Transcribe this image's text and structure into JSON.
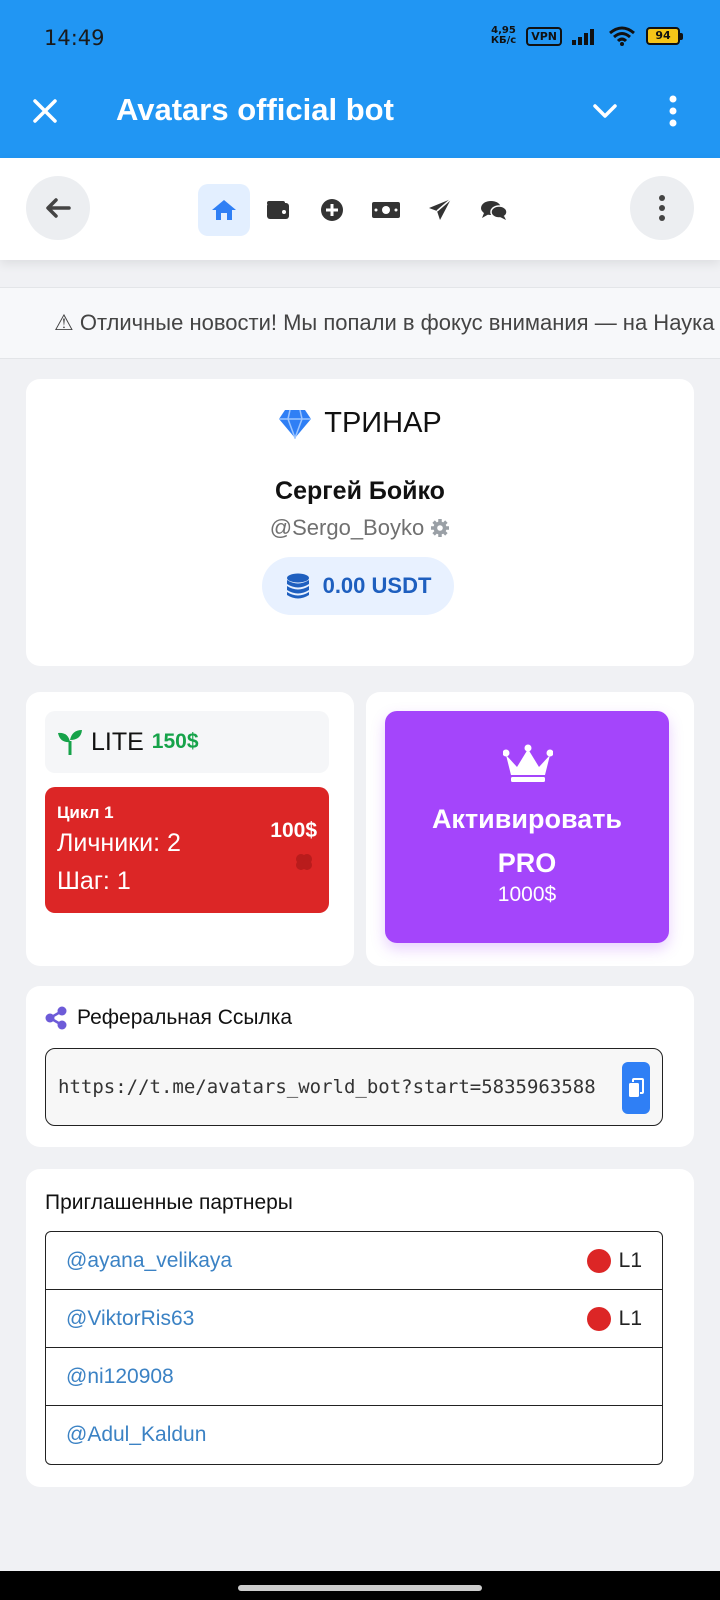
{
  "status_bar": {
    "time": "14:49",
    "net_speed_value": "4,95",
    "net_speed_unit": "КБ/с",
    "vpn": "VPN",
    "battery": "94"
  },
  "app_bar": {
    "title": "Avatars official bot"
  },
  "nav": {
    "icons": [
      "home-icon",
      "wallet-icon",
      "plus-circle-icon",
      "money-icon",
      "send-icon",
      "chat-icon"
    ],
    "active": "home-icon"
  },
  "ticker": {
    "text": "⚠ Отличные новости! Мы попали в фокус внимания — на Наука"
  },
  "profile": {
    "rank": "ТРИНАР",
    "name": "Сергей Бойко",
    "handle": "@Sergo_Boyko",
    "balance": "0.00 USDT"
  },
  "lite": {
    "name": "LITE",
    "price": "150$",
    "cycle_title": "Цикл 1",
    "personal": "Личники: 2",
    "step": "Шаг: 1",
    "cycle_price": "100$"
  },
  "pro": {
    "title_line1": "Активировать",
    "title_line2": "PRO",
    "price": "1000$"
  },
  "referral": {
    "title": "Реферальная Ссылка",
    "link": "https://t.me/avatars_world_bot?start=5835963588"
  },
  "partners": {
    "title": "Приглашенные партнеры",
    "rows": [
      {
        "name": "@ayana_velikaya",
        "level": "L1"
      },
      {
        "name": "@ViktorRis63",
        "level": "L1"
      },
      {
        "name": "@ni120908",
        "level": ""
      },
      {
        "name": "@Adul_Kaldun",
        "level": ""
      }
    ]
  },
  "colors": {
    "telegram_blue": "#2196f3",
    "lite_green": "#16a34a",
    "cycle_red": "#dc2626",
    "pro_purple": "#a445fb",
    "link_blue": "#3b82c4"
  }
}
